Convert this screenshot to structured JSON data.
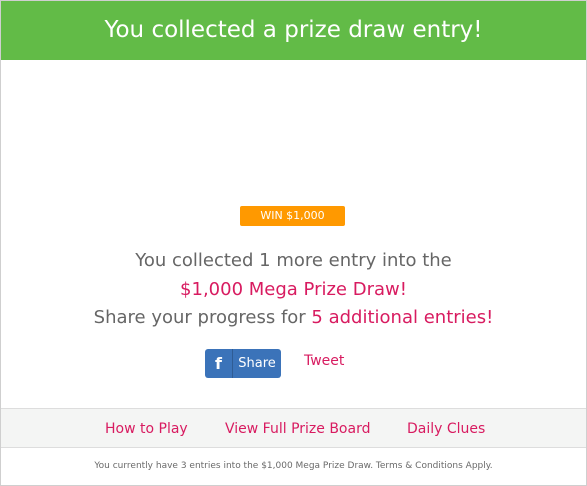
{
  "header": {
    "title": "You collected a prize draw entry!"
  },
  "badge": {
    "label": "WIN $1,000"
  },
  "message": {
    "line1": "You collected 1 more entry into the",
    "line2": "$1,000 Mega Prize Draw!",
    "line3_prefix": "Share your progress for ",
    "line3_highlight": "5 additional entries!"
  },
  "social": {
    "facebook_icon": "f",
    "facebook_label": "Share",
    "tweet_label": "Tweet"
  },
  "nav": {
    "how_to_play": "How to Play",
    "prize_board": "View Full Prize Board",
    "daily_clues": "Daily Clues"
  },
  "footer": {
    "disclaimer": "You currently have 3 entries into the $1,000 Mega Prize Draw. Terms & Conditions Apply."
  },
  "colors": {
    "header_green": "#62bb47",
    "badge_orange": "#ff9900",
    "accent_pink": "#d81b60",
    "facebook_blue": "#3b73b9"
  }
}
